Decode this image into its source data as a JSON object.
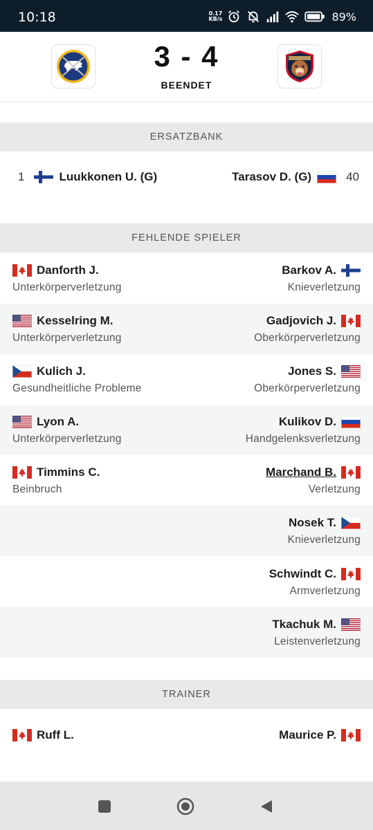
{
  "status_bar": {
    "time": "10:18",
    "net_speed_top": "0.17",
    "net_speed_bottom": "KB/s",
    "battery": "89%",
    "icons": [
      "alarm-icon",
      "mute-icon",
      "signal-icon",
      "wifi-icon",
      "battery-icon"
    ]
  },
  "match": {
    "home_team_logo": "buffalo-sabres-logo",
    "away_team_logo": "florida-panthers-logo",
    "score": "3 - 4",
    "status": "BEENDET"
  },
  "bench": {
    "header": "ERSATZBANK",
    "left": {
      "number": "1",
      "flag": "FI",
      "name": "Luukkonen U. (G)"
    },
    "right": {
      "number": "40",
      "flag": "RU",
      "name": "Tarasov D. (G)"
    }
  },
  "missing": {
    "header": "FEHLENDE SPIELER",
    "rows": [
      {
        "left": {
          "flag": "CA",
          "name": "Danforth J.",
          "injury": "Unterkörperverletzung"
        },
        "right": {
          "flag": "FI",
          "name": "Barkov A.",
          "injury": "Knieverletzung"
        }
      },
      {
        "left": {
          "flag": "US",
          "name": "Kesselring M.",
          "injury": "Unterkörperverletzung"
        },
        "right": {
          "flag": "CA",
          "name": "Gadjovich J.",
          "injury": "Oberkörperverletzung"
        }
      },
      {
        "left": {
          "flag": "CZ",
          "name": "Kulich J.",
          "injury": "Gesundheitliche Probleme"
        },
        "right": {
          "flag": "US",
          "name": "Jones S.",
          "injury": "Oberkörperverletzung"
        }
      },
      {
        "left": {
          "flag": "US",
          "name": "Lyon A.",
          "injury": "Unterkörperverletzung"
        },
        "right": {
          "flag": "RU",
          "name": "Kulikov D.",
          "injury": "Handgelenksverletzung"
        }
      },
      {
        "left": {
          "flag": "CA",
          "name": "Timmins C.",
          "injury": "Beinbruch"
        },
        "right": {
          "flag": "CA",
          "name": "Marchand B.",
          "injury": "Verletzung"
        }
      },
      {
        "right": {
          "flag": "CZ",
          "name": "Nosek T.",
          "injury": "Knieverletzung"
        }
      },
      {
        "right": {
          "flag": "CA",
          "name": "Schwindt C.",
          "injury": "Armverletzung"
        }
      },
      {
        "right": {
          "flag": "US",
          "name": "Tkachuk M.",
          "injury": "Leistenverletzung"
        }
      }
    ]
  },
  "coach": {
    "header": "TRAINER",
    "left": {
      "flag": "CA",
      "name": "Ruff L."
    },
    "right": {
      "flag": "CA",
      "name": "Maurice P."
    }
  },
  "nav": {
    "buttons": [
      "recent-apps-icon",
      "home-icon",
      "back-icon"
    ]
  },
  "colors": {
    "status_bar_bg": "#0e1d2a",
    "section_header_bg": "#e9e9e9",
    "alt_row_bg": "#f4f6f6"
  }
}
